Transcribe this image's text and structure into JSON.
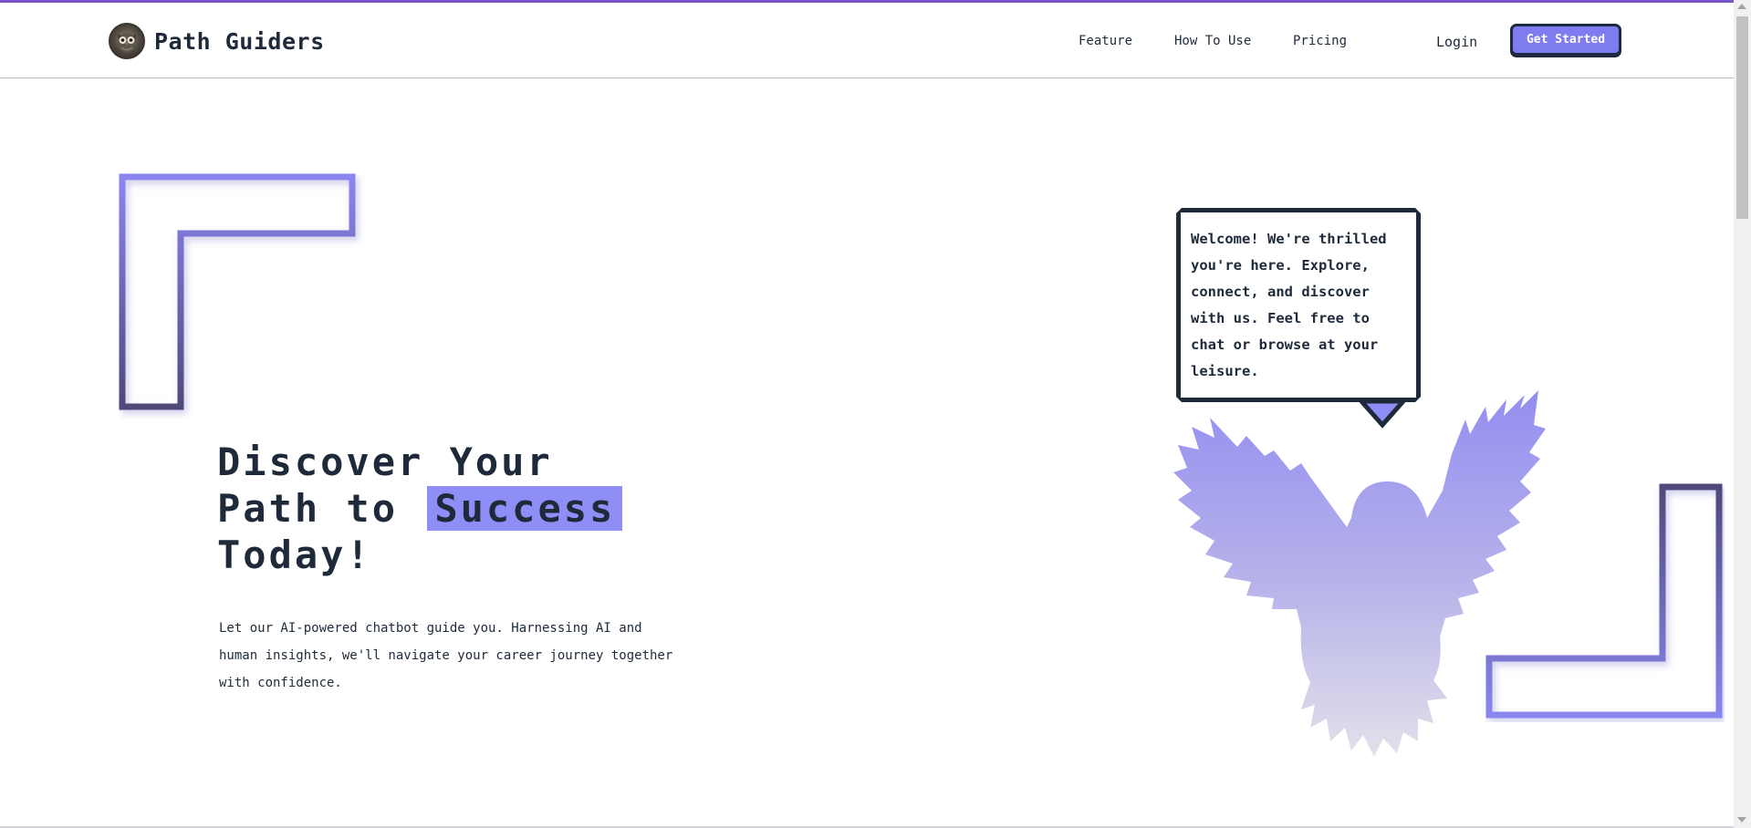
{
  "brand": {
    "name": "Path Guiders",
    "logo_icon": "owl-logo-icon"
  },
  "nav": {
    "links": [
      {
        "label": "Feature"
      },
      {
        "label": "How To Use"
      },
      {
        "label": "Pricing"
      }
    ],
    "login_label": "Login",
    "cta_label": "Get Started"
  },
  "hero": {
    "title_line1": "Discover Your",
    "title_line2_prefix": "Path to",
    "title_highlight": "Success",
    "title_line3": "Today!",
    "description": "Let our AI-powered chatbot guide you. Harnessing AI and human insights, we'll navigate your career journey together with confidence."
  },
  "speech_bubble": {
    "text": "Welcome! We're thrilled you're here. Explore, connect, and discover with us. Feel free to chat or browse at your leisure."
  },
  "colors": {
    "accent": "#7f7cf0",
    "highlight": "#8f8ef7",
    "text_dark": "#1e2a3a",
    "top_bar": "#7a55c8"
  }
}
